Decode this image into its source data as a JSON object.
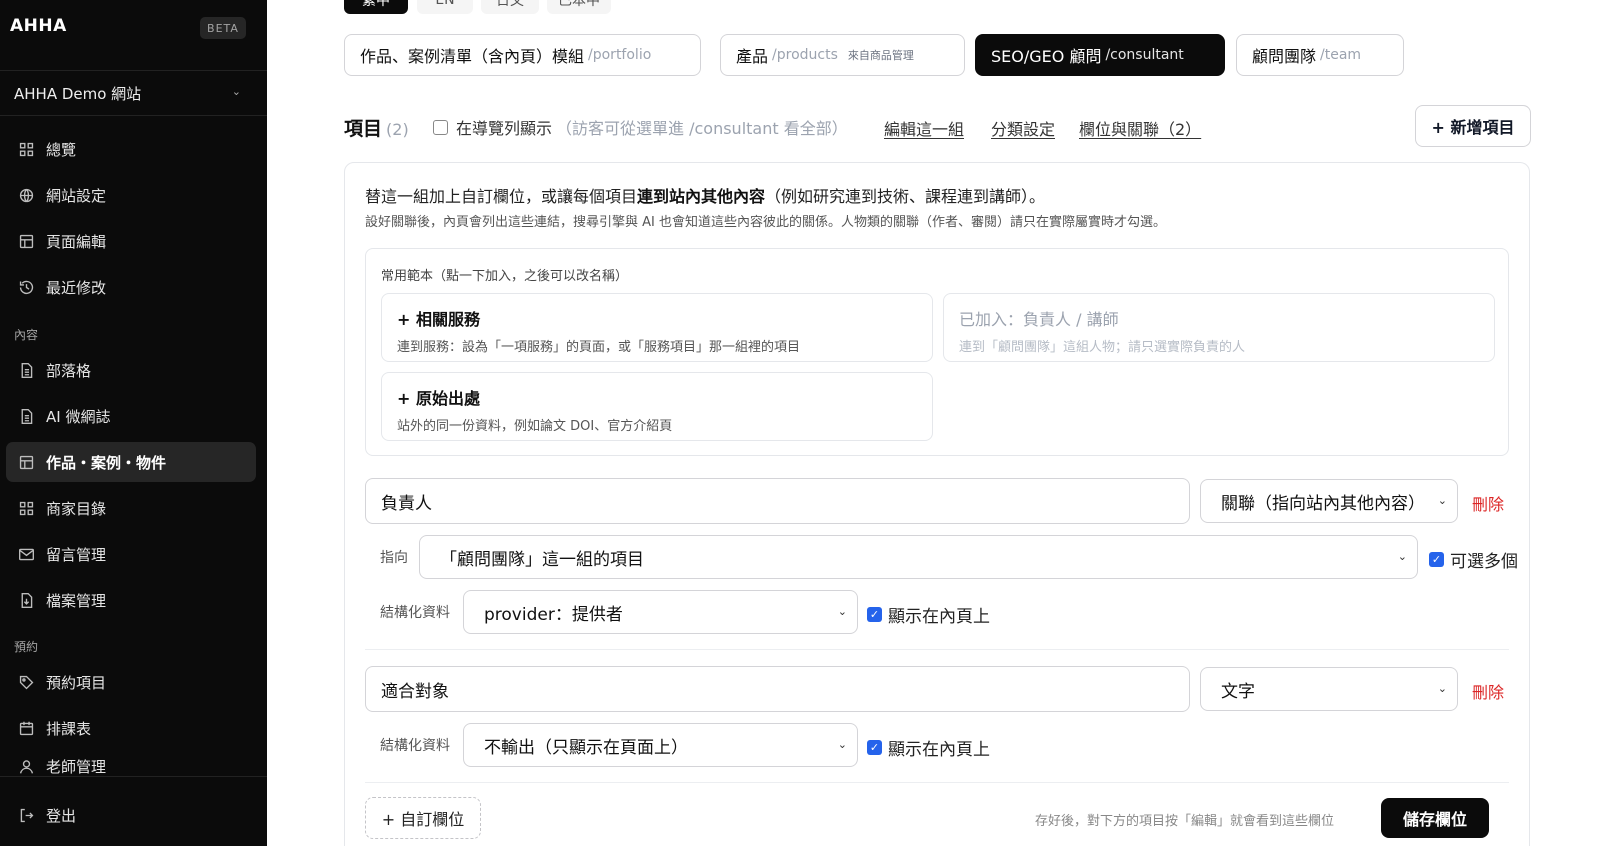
{
  "sidebar": {
    "brand": "AHHA",
    "beta": "BETA",
    "site_selector": "AHHA Demo 網站",
    "items_top": [
      {
        "label": "總覽",
        "icon": "grid-icon"
      },
      {
        "label": "網站設定",
        "icon": "globe-icon"
      },
      {
        "label": "頁面編輯",
        "icon": "layout-icon"
      },
      {
        "label": "最近修改",
        "icon": "history-icon"
      }
    ],
    "section_content": "內容",
    "items_content": [
      {
        "label": "部落格",
        "icon": "file-text-icon"
      },
      {
        "label": "AI 微網誌",
        "icon": "file-text-icon"
      },
      {
        "label": "作品・案例・物件",
        "icon": "layout-icon",
        "active": true
      },
      {
        "label": "商家目錄",
        "icon": "grid-icon"
      },
      {
        "label": "留言管理",
        "icon": "mail-icon"
      },
      {
        "label": "檔案管理",
        "icon": "file-download-icon"
      }
    ],
    "section_booking": "預約",
    "items_booking": [
      {
        "label": "預約項目",
        "icon": "tag-icon"
      },
      {
        "label": "排課表",
        "icon": "calendar-icon"
      },
      {
        "label": "老師管理",
        "icon": "user-icon"
      }
    ],
    "logout": "登出"
  },
  "lang_tabs": [
    "繁中",
    "EN",
    "日文",
    "已本中"
  ],
  "module_tabs": [
    {
      "label": "作品、案例清單（含內頁）模組",
      "slug": "/portfolio",
      "note": ""
    },
    {
      "label": "產品",
      "slug": "/products",
      "note": "來自商品管理"
    },
    {
      "label": "SEO/GEO 顧問",
      "slug": "/consultant",
      "note": "",
      "active": true
    },
    {
      "label": "顧問團隊",
      "slug": "/team",
      "note": ""
    }
  ],
  "items_header": {
    "title": "項目",
    "count": "(2)",
    "nav_checkbox_label": "在導覽列顯示",
    "nav_checkbox_hint": "（訪客可從選單進 /consultant 看全部）",
    "links": [
      "編輯這一組",
      "分類設定",
      "欄位與關聯（2）"
    ],
    "add_button": "+ 新增項目"
  },
  "fields_panel": {
    "intro_prefix": "替這一組加上自訂欄位，或讓每個項目",
    "intro_bold": "連到站內其他內容",
    "intro_suffix": "（例如研究連到技術、課程連到講師）。",
    "intro_note": "設好關聯後，內頁會列出這些連結，搜尋引擎與 AI 也會知道這些內容彼此的關係。人物類的關聯（作者、審閱）請只在實際屬實時才勾選。",
    "templates_heading": "常用範本（點一下加入，之後可以改名稱）",
    "templates": [
      {
        "title": "+ 相關服務",
        "desc": "連到服務：設為「一項服務」的頁面，或「服務項目」那一組裡的項目",
        "disabled": false
      },
      {
        "title": "已加入：負責人 / 講師",
        "desc": "連到「顧問團隊」這組人物；請只選實際負責的人",
        "disabled": true
      },
      {
        "title": "+ 原始出處",
        "desc": "站外的同一份資料，例如論文 DOI、官方介紹頁",
        "disabled": false
      }
    ],
    "field1": {
      "name": "負責人",
      "type": "關聯（指向站內其他內容）",
      "delete": "刪除",
      "target_label": "指向",
      "target": "「顧問團隊」這一組的項目",
      "multi_label": "可選多個",
      "schema_label": "結構化資料",
      "schema": "provider：提供者",
      "show_label": "顯示在內頁上"
    },
    "field2": {
      "name": "適合對象",
      "type": "文字",
      "delete": "刪除",
      "schema_label": "結構化資料",
      "schema": "不輸出（只顯示在頁面上）",
      "show_label": "顯示在內頁上"
    },
    "custom_button": "+ 自訂欄位",
    "save_hint": "存好後，對下方的項目按「編輯」就會看到這些欄位",
    "save_button": "儲存欄位"
  },
  "colors": {
    "sidebar_bg": "#0b0b0b",
    "active_tab": "#0b0b0b",
    "danger": "#dc2626",
    "checkbox": "#2563eb"
  }
}
